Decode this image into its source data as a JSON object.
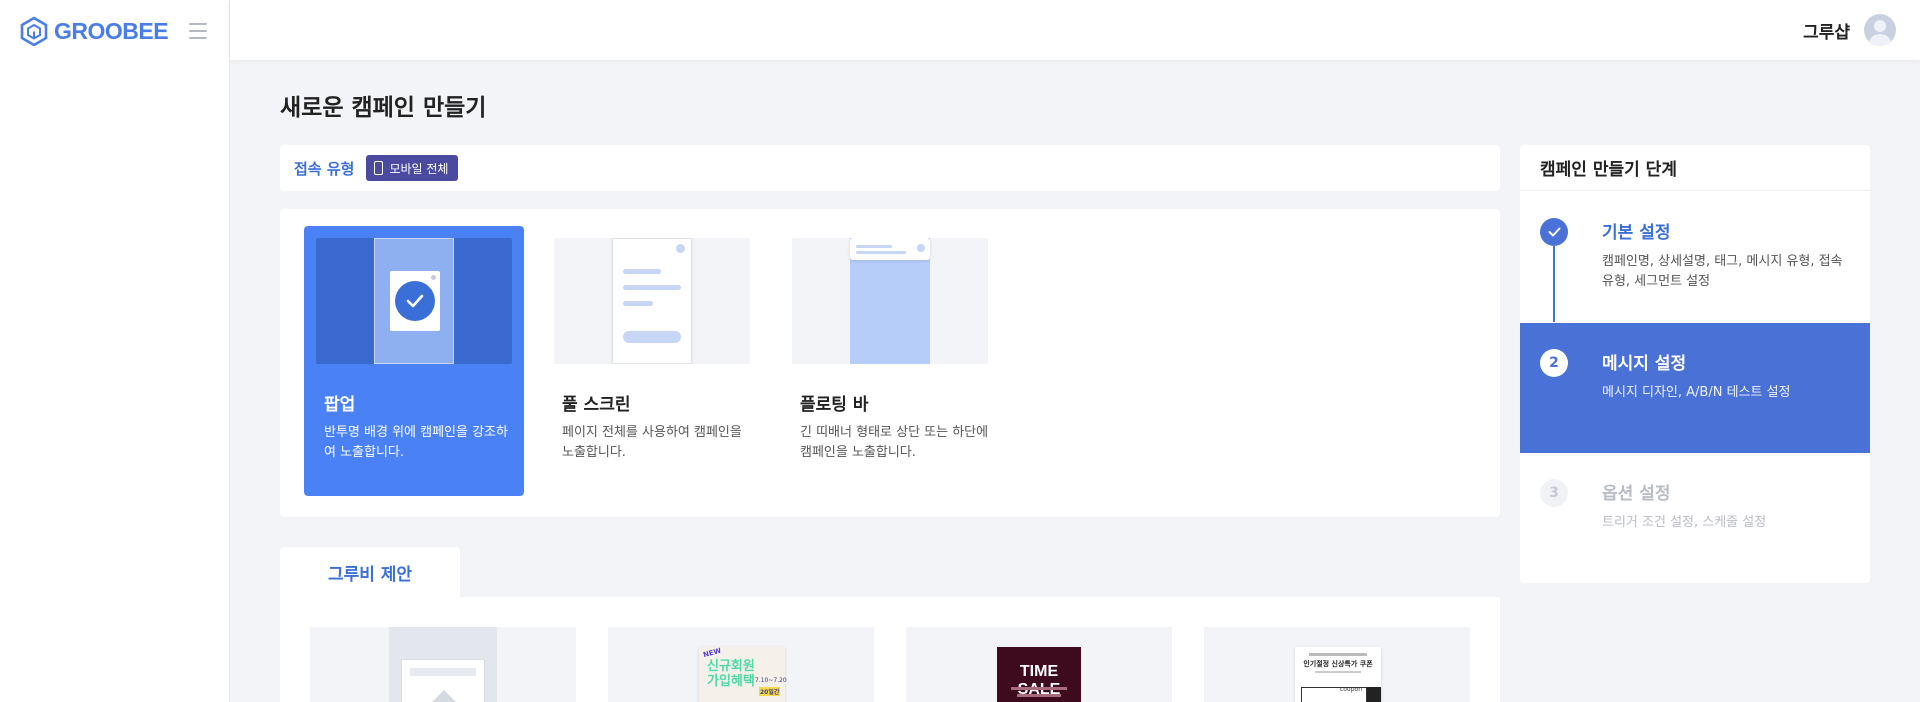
{
  "brand": {
    "name": "GROOBEE",
    "color": "#4a7ee6"
  },
  "topbar": {
    "user_name": "그루샵"
  },
  "page": {
    "title": "새로운 캠페인 만들기"
  },
  "access": {
    "label": "접속 유형",
    "chip": "모바일 전체"
  },
  "types": [
    {
      "title": "팝업",
      "desc": "반투명 배경 위에 캠페인을 강조하여 노출합니다.",
      "selected": true
    },
    {
      "title": "풀 스크린",
      "desc": "페이지 전체를 사용하여 캠페인을 노출합니다.",
      "selected": false
    },
    {
      "title": "플로팅 바",
      "desc": "긴 띠배너 형태로 상단 또는 하단에 캠페인을 노출합니다.",
      "selected": false
    }
  ],
  "suggestions": {
    "tab_label": "그루비 제안",
    "templates": [
      {
        "text": ""
      },
      {
        "text": "신규회원 가입혜택",
        "badge": "NEW",
        "date": "7.10~7.20",
        "note": "20일간"
      },
      {
        "text": "TIME SALE"
      },
      {
        "text": "인기절정 신상특가 쿠폰",
        "sub": "coupon"
      }
    ]
  },
  "steps": {
    "header": "캠페인 만들기 단계",
    "items": [
      {
        "marker": "✓",
        "title": "기본 설정",
        "desc": "캠페인명, 상세설명, 태그, 메시지 유형, 접속 유형, 세그먼트 설정",
        "state": "done"
      },
      {
        "marker": "2",
        "title": "메시지 설정",
        "desc": "메시지 디자인, A/B/N 테스트 설정",
        "state": "active"
      },
      {
        "marker": "3",
        "title": "옵션 설정",
        "desc": "트리거 조건 설정, 스케줄 설정",
        "state": "pending"
      }
    ]
  },
  "colors": {
    "accent": "#4a82f5",
    "step_active": "#4a72d6",
    "chip": "#4a4aa0"
  }
}
